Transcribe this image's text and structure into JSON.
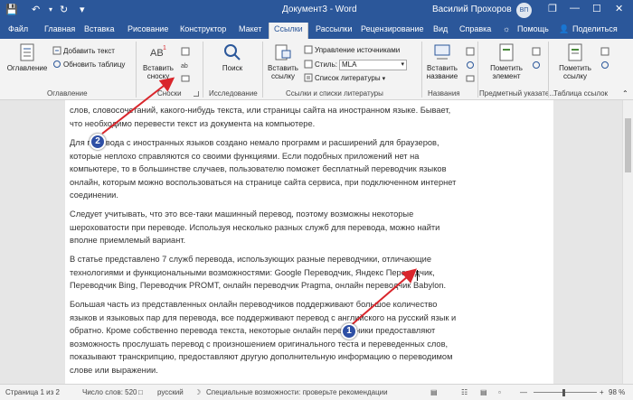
{
  "titlebar": {
    "doc_title": "Документ3 - Word",
    "user_name": "Василий Прохоров",
    "avatar_initials": "ВП"
  },
  "tabs": [
    "Файл",
    "Главная",
    "Вставка",
    "Рисование",
    "Конструктор",
    "Макет",
    "Ссылки",
    "Рассылки",
    "Рецензирование",
    "Вид",
    "Справка"
  ],
  "tabs_right": {
    "help": "Помощь",
    "share": "Поделиться"
  },
  "ribbon": {
    "toc": {
      "button": "Оглавление",
      "add_text": "Добавить текст",
      "update_table": "Обновить таблицу",
      "group": "Оглавление"
    },
    "footnotes": {
      "insert_line1": "Вставить",
      "insert_line2": "сноску",
      "group": "Сноски"
    },
    "research": {
      "search": "Поиск",
      "group": "Исследование"
    },
    "citations": {
      "insert_line1": "Вставить",
      "insert_line2": "ссылку",
      "manage_sources": "Управление источниками",
      "style_label": "Стиль:",
      "style_value": "MLA",
      "bibliography": "Список литературы",
      "group": "Ссылки и списки литературы"
    },
    "captions": {
      "insert_line1": "Вставить",
      "insert_line2": "название",
      "group": "Названия"
    },
    "index": {
      "mark_line1": "Пометить",
      "mark_line2": "элемент",
      "group": "Предметный указате..."
    },
    "authorities": {
      "mark_line1": "Пометить",
      "mark_line2": "ссылку",
      "group": "Таблица ссылок"
    }
  },
  "document": {
    "paragraphs": [
      [
        "слов, словосочетаний, какого-нибудь текста, или страницы сайта на иностранном языке. Бывает,",
        "что необходимо перевести текст из документа на компьютере."
      ],
      [
        "Для перевода с иностранных языков создано немало программ и расширений для браузеров,",
        "которые неплохо справляются со своими функциями. Если подобных приложений нет на",
        "компьютере, то в большинстве случаев, пользователю поможет бесплатный переводчик языков",
        "онлайн, которым можно воспользоваться на странице сайта сервиса, при подключенном интернет",
        "соединении."
      ],
      [
        "Следует учитывать, что это все-таки машинный перевод, поэтому возможны некоторые",
        "шероховатости при переводе. Используя несколько разных служб для перевода, можно найти",
        "вполне приемлемый вариант."
      ],
      [
        "В статье представлено 7 служб перевода, использующих разные переводчики, отличающие",
        "технологиями и функциональными возможностями: Google Переводчик, Яндекс Переводчик,",
        "Переводчик Bing, Переводчик PROMT, онлайн переводчик Pragma, онлайн переводчик Babylon."
      ],
      [
        "Большая часть из представленных онлайн переводчиков поддерживают большое количество",
        "языков и языковых пар для перевода, все поддерживают перевод с английского на русский язык и",
        "обратно. Кроме собственно перевода текста, некоторые онлайн переводчики предоставляют",
        "возможность прослушать перевод с произношением оригинального теста и переведенных слов,",
        "показывают транскрипцию, предоставляют другую дополнительную информацию о переводимом",
        "слове или выражении."
      ]
    ]
  },
  "status": {
    "page": "Страница 1 из 2",
    "words": "Число слов: 520",
    "language": "русский",
    "accessibility": "Специальные возможности: проверьте рекомендации",
    "zoom": "98 %"
  },
  "callouts": [
    "1",
    "2"
  ],
  "colors": {
    "brand": "#2b579a",
    "callout": "#2e4fa5",
    "arrow": "#d9262c"
  },
  "icons": [
    "save-icon",
    "undo-icon",
    "redo-icon",
    "customize-icon",
    "lightbulb-icon",
    "share-icon",
    "restore-icon",
    "minimize-icon",
    "maximize-icon",
    "close-icon"
  ]
}
